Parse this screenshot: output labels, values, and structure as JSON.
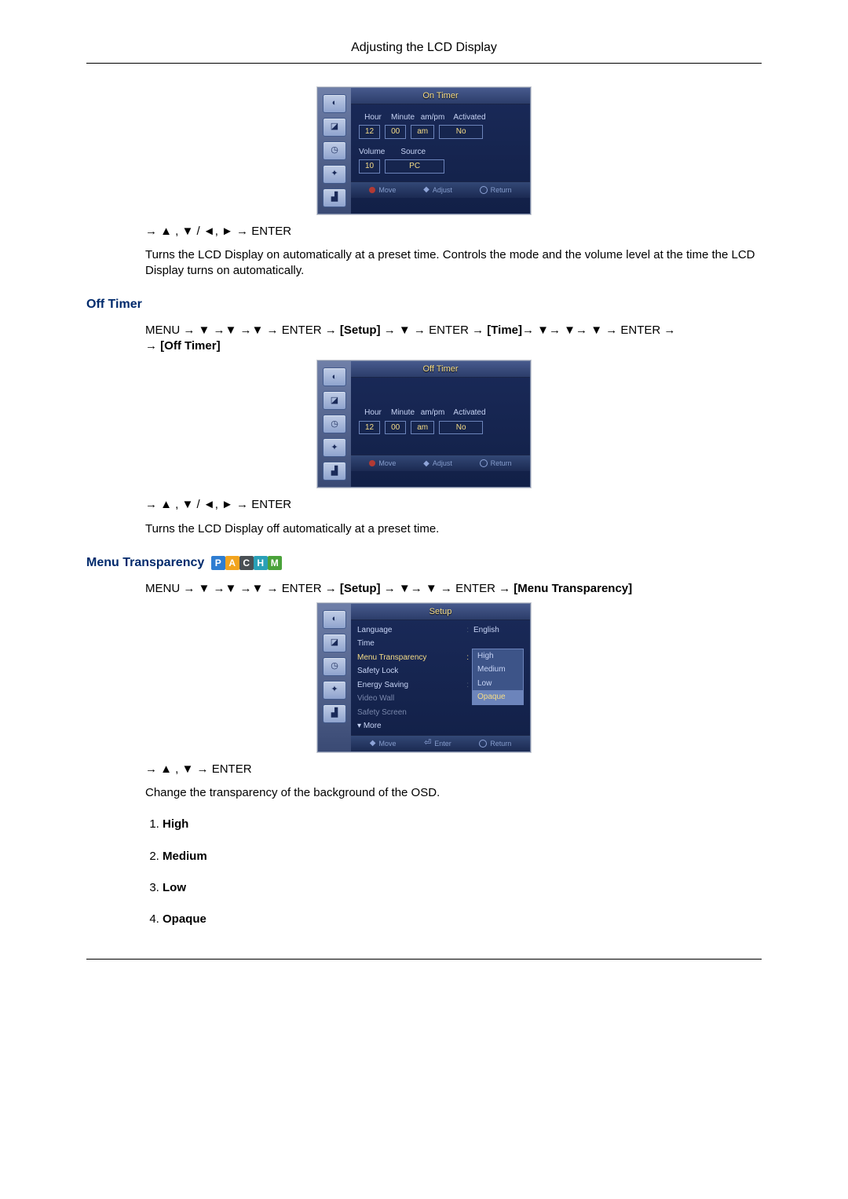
{
  "header": {
    "title": "Adjusting the LCD Display"
  },
  "nav_arrows": {
    "two_dir": "→ ▲ , ▼ / ◄, ► → ENTER",
    "one_dir": "→ ▲ , ▼ → ENTER"
  },
  "on_timer": {
    "osd_title": "On Timer",
    "labels": {
      "hour": "Hour",
      "minute": "Minute",
      "ampm": "am/pm",
      "activated": "Activated",
      "volume": "Volume",
      "source": "Source"
    },
    "values": {
      "hour": "12",
      "minute": "00",
      "ampm": "am",
      "activated": "No",
      "volume": "10",
      "source": "PC"
    },
    "footer": {
      "move": "Move",
      "adjust": "Adjust",
      "return": "Return"
    },
    "desc": "Turns the LCD Display on automatically at a preset time. Controls the mode and the volume level at the time the LCD Display turns on automatically."
  },
  "off_timer": {
    "heading": "Off Timer",
    "menu_path_prefix": "MENU → ▼ →▼ →▼ → ENTER → ",
    "setup_token": "[Setup]",
    "mid": " → ▼ → ENTER → ",
    "time_token": "[Time]",
    "tail": "→ ▼→ ▼→ ▼ → ENTER → ",
    "off_token": "[Off Timer]",
    "osd_title": "Off Timer",
    "labels": {
      "hour": "Hour",
      "minute": "Minute",
      "ampm": "am/pm",
      "activated": "Activated"
    },
    "values": {
      "hour": "12",
      "minute": "00",
      "ampm": "am",
      "activated": "No"
    },
    "footer": {
      "move": "Move",
      "adjust": "Adjust",
      "return": "Return"
    },
    "desc": "Turns the LCD Display off automatically at a preset time."
  },
  "menu_transparency": {
    "heading": "Menu Transparency",
    "badges": [
      "P",
      "A",
      "C",
      "H",
      "M"
    ],
    "menu_path_prefix": "MENU → ▼ →▼ →▼ → ENTER → ",
    "setup_token": "[Setup]",
    "mid": " → ▼→ ▼ → ENTER → ",
    "mt_token": "[Menu Transparency]",
    "osd_title": "Setup",
    "setup_items": {
      "language_lbl": "Language",
      "language_val": "English",
      "time_lbl": "Time",
      "mt_lbl": "Menu Transparency",
      "safety_lock_lbl": "Safety Lock",
      "energy_lbl": "Energy Saving",
      "video_wall_lbl": "Video Wall",
      "safety_screen_lbl": "Safety Screen",
      "more_lbl": "More"
    },
    "dropdown": {
      "opt1": "High",
      "opt2": "Medium",
      "opt3": "Low",
      "opt4": "Opaque"
    },
    "footer": {
      "move": "Move",
      "enter": "Enter",
      "return": "Return"
    },
    "desc": "Change the transparency of the background of the OSD.",
    "options": {
      "o1": "High",
      "o2": "Medium",
      "o3": "Low",
      "o4": "Opaque"
    }
  }
}
